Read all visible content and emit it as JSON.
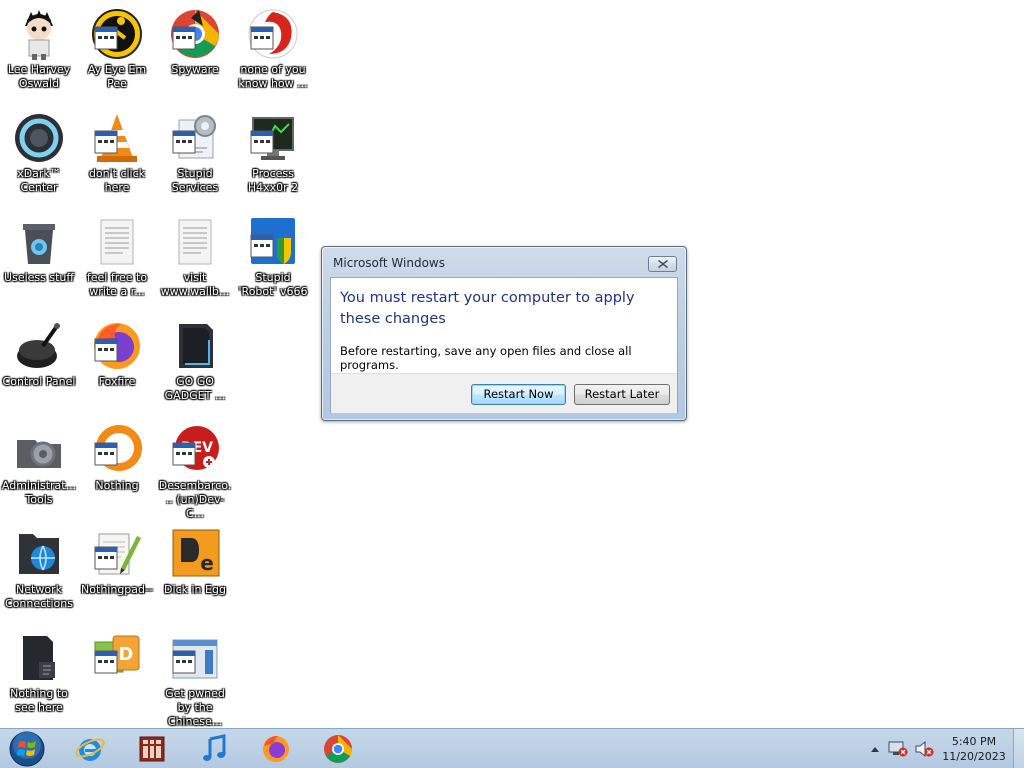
{
  "desktop": {
    "icons": [
      {
        "label": "Lee Harvey Oswald",
        "icon": "anime-character-icon"
      },
      {
        "label": "Ay Eye Em Pee",
        "icon": "aim-running-man-icon"
      },
      {
        "label": "Spyware",
        "icon": "chrome-spyware-icon"
      },
      {
        "label": "none of you know how ...",
        "icon": "red-swirl-icon"
      },
      {
        "label": "xDark™ Center",
        "icon": "dark-center-ring-icon"
      },
      {
        "label": "don't click here",
        "icon": "traffic-cone-icon"
      },
      {
        "label": "Stupid Services",
        "icon": "services-gear-icon"
      },
      {
        "label": "Process H4xx0r 2",
        "icon": "process-monitor-icon"
      },
      {
        "label": "Useless stuff",
        "icon": "trash-bin-icon"
      },
      {
        "label": "feel free to write a r...",
        "icon": "text-document-icon"
      },
      {
        "label": "visit www.wallb...",
        "icon": "text-document-icon"
      },
      {
        "label": "Stupid 'Robot' v666",
        "icon": "shield-installer-icon"
      },
      {
        "label": "Control Panel",
        "icon": "control-panel-icon"
      },
      {
        "label": "Foxfire",
        "icon": "foxfire-icon"
      },
      {
        "label": "GO GO GADGET ...",
        "icon": "gadget-box-icon"
      },
      {
        "label": "Administrat... Tools",
        "icon": "admin-tools-icon"
      },
      {
        "label": "Nothing",
        "icon": "orange-ring-icon"
      },
      {
        "label": "Desembarco... (un)Dev-C...",
        "icon": "dev-cpp-icon"
      },
      {
        "label": "Network Connections",
        "icon": "network-globe-icon"
      },
      {
        "label": "Nothingpad--",
        "icon": "notepad-pencil-icon"
      },
      {
        "label": "Dick in Egg",
        "icon": "egg-editor-icon"
      },
      {
        "label": "Nothing to see here",
        "icon": "dark-folder-icon"
      },
      {
        "label": "",
        "icon": "hex-editor-icon"
      },
      {
        "label": "Get pwned by the Chinese...",
        "icon": "window-app-icon"
      }
    ]
  },
  "dialog": {
    "title": "Microsoft Windows",
    "main_instruction": "You must restart your computer to apply these changes",
    "content": "Before restarting, save any open files and close all programs.",
    "buttons": {
      "restart_now": "Restart Now",
      "restart_later": "Restart Later"
    },
    "close_icon": "close-icon"
  },
  "taskbar": {
    "start_icon": "windows-orb-icon",
    "pinned": [
      {
        "name": "taskbar-internet-explorer",
        "icon": "internet-explorer-icon"
      },
      {
        "name": "taskbar-store",
        "icon": "store-window-icon"
      },
      {
        "name": "taskbar-music",
        "icon": "music-note-icon"
      },
      {
        "name": "taskbar-firefox",
        "icon": "firefox-icon"
      },
      {
        "name": "taskbar-chrome",
        "icon": "chrome-icon"
      }
    ],
    "tray": {
      "icons": [
        "show-hidden-icons-icon",
        "network-error-icon",
        "volume-muted-icon"
      ],
      "time": "5:40 PM",
      "date": "11/20/2023"
    }
  },
  "colors": {
    "dialog_heading": "#1e3287",
    "taskbar": "#c7d8ea",
    "default_button_border": "#3c7fb1"
  }
}
